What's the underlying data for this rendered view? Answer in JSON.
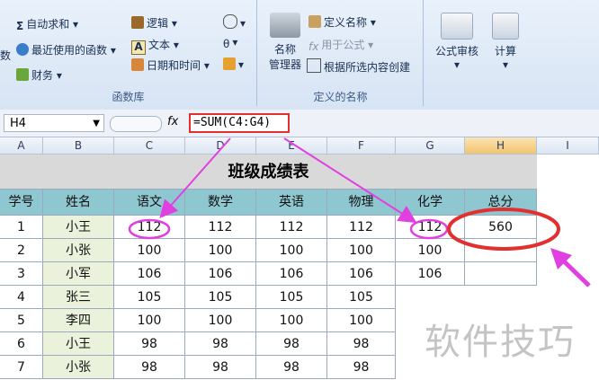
{
  "ribbon": {
    "groups": [
      {
        "title": "函数库",
        "items": [
          "自动求和",
          "逻辑",
          "最近使用的函数",
          "文本",
          "财务",
          "日期和时间"
        ],
        "left_stub": "数"
      },
      {
        "title": "定义的名称",
        "big": "名称\n管理器",
        "big1": "名称",
        "big2": "管理器",
        "items": [
          "定义名称",
          "用于公式",
          "根据所选内容创建"
        ]
      },
      {
        "title": "",
        "audit": "公式审核",
        "calc": "计算"
      }
    ]
  },
  "formula_bar": {
    "name_box": "H4",
    "fx": "fx",
    "formula": "=SUM(C4:G4)"
  },
  "columns": [
    "A",
    "B",
    "C",
    "D",
    "E",
    "F",
    "G",
    "H",
    "I"
  ],
  "sheet": {
    "title": "班级成绩表",
    "headers": [
      "学号",
      "姓名",
      "语文",
      "数学",
      "英语",
      "物理",
      "化学",
      "总分"
    ],
    "rows": [
      [
        "1",
        "小王",
        "112",
        "112",
        "112",
        "112",
        "112",
        "560"
      ],
      [
        "2",
        "小张",
        "100",
        "100",
        "100",
        "100",
        "100",
        ""
      ],
      [
        "3",
        "小军",
        "106",
        "106",
        "106",
        "106",
        "106",
        ""
      ],
      [
        "4",
        "张三",
        "105",
        "105",
        "105",
        "105",
        "",
        ""
      ],
      [
        "5",
        "李四",
        "100",
        "100",
        "100",
        "100",
        "",
        ""
      ],
      [
        "6",
        "小王",
        "98",
        "98",
        "98",
        "98",
        "",
        ""
      ],
      [
        "7",
        "小张",
        "98",
        "98",
        "98",
        "98",
        "",
        ""
      ]
    ]
  },
  "watermark": "软件技巧",
  "colors": {
    "header_fill": "#8fc7d1",
    "name_fill": "#eaf2dc",
    "annotation_red": "#e23030",
    "annotation_magenta": "#e040e0"
  }
}
